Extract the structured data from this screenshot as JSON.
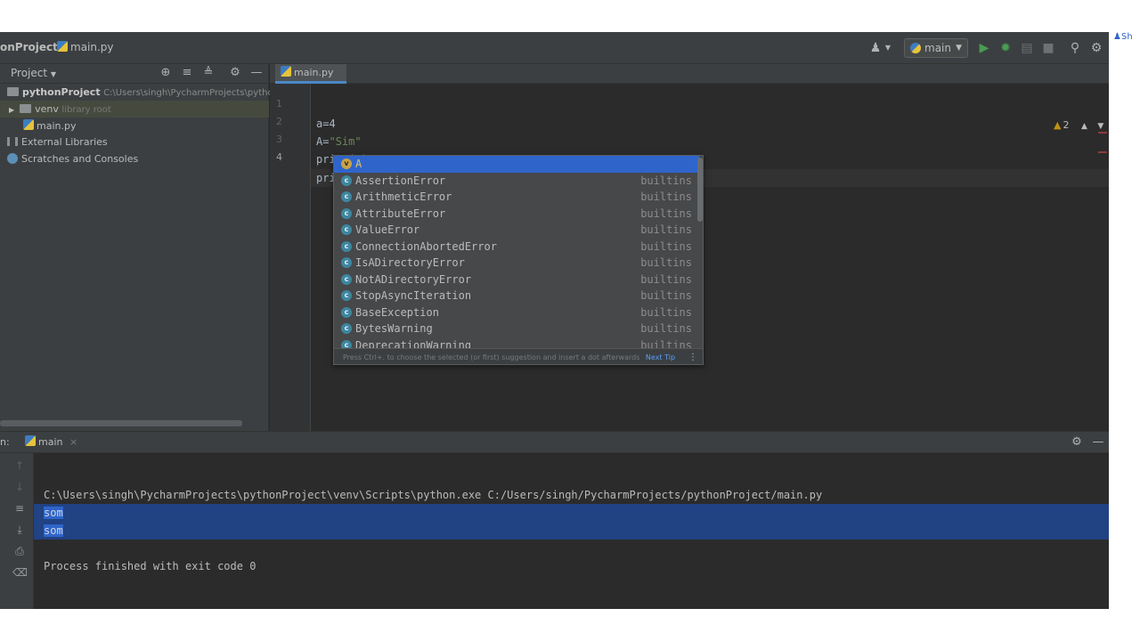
{
  "navbar": {
    "project_crumb": "onProject",
    "file_crumb": "main.py",
    "run_config": "main",
    "share_label": "Sh"
  },
  "project_panel": {
    "title": "Project",
    "tree": [
      {
        "label": "pythonProject",
        "path": "C:\\Users\\singh\\PycharmProjects\\pythonP"
      },
      {
        "label": "venv",
        "hint": "library root"
      },
      {
        "label": "main.py"
      },
      {
        "label": "External Libraries"
      },
      {
        "label": "Scratches and Consoles"
      }
    ]
  },
  "editor": {
    "tab_label": "main.py",
    "line_numbers": [
      "1",
      "2",
      "3",
      "4"
    ],
    "lines": [
      "a=4",
      "A=",
      "\"Sim\"",
      "print(a)",
      "print(",
      "A",
      ")"
    ],
    "warnings": "2"
  },
  "completion": {
    "items": [
      {
        "badge": "v",
        "name": "A",
        "type": ""
      },
      {
        "badge": "c",
        "name": "AssertionError",
        "type": "builtins"
      },
      {
        "badge": "c",
        "name": "ArithmeticError",
        "type": "builtins"
      },
      {
        "badge": "c",
        "name": "AttributeError",
        "type": "builtins"
      },
      {
        "badge": "c",
        "name": "ValueError",
        "type": "builtins"
      },
      {
        "badge": "c",
        "name": "ConnectionAbortedError",
        "type": "builtins"
      },
      {
        "badge": "c",
        "name": "IsADirectoryError",
        "type": "builtins"
      },
      {
        "badge": "c",
        "name": "NotADirectoryError",
        "type": "builtins"
      },
      {
        "badge": "c",
        "name": "StopAsyncIteration",
        "type": "builtins"
      },
      {
        "badge": "c",
        "name": "BaseException",
        "type": "builtins"
      },
      {
        "badge": "c",
        "name": "BytesWarning",
        "type": "builtins"
      },
      {
        "badge": "c",
        "name": "DeprecationWarning",
        "type": "builtins"
      }
    ],
    "footer_hint": "Press Ctrl+. to choose the selected (or first) suggestion and insert a dot afterwards",
    "footer_tip": "Next Tip",
    "more_glyph": "⋮"
  },
  "run_panel": {
    "label_prefix": "n:",
    "tab_label": "main",
    "command": "C:\\Users\\singh\\PycharmProjects\\pythonProject\\venv\\Scripts\\python.exe C:/Users/singh/PycharmProjects/pythonProject/main.py",
    "output": [
      "som",
      "som"
    ],
    "exit_message": "Process finished with exit code 0"
  }
}
